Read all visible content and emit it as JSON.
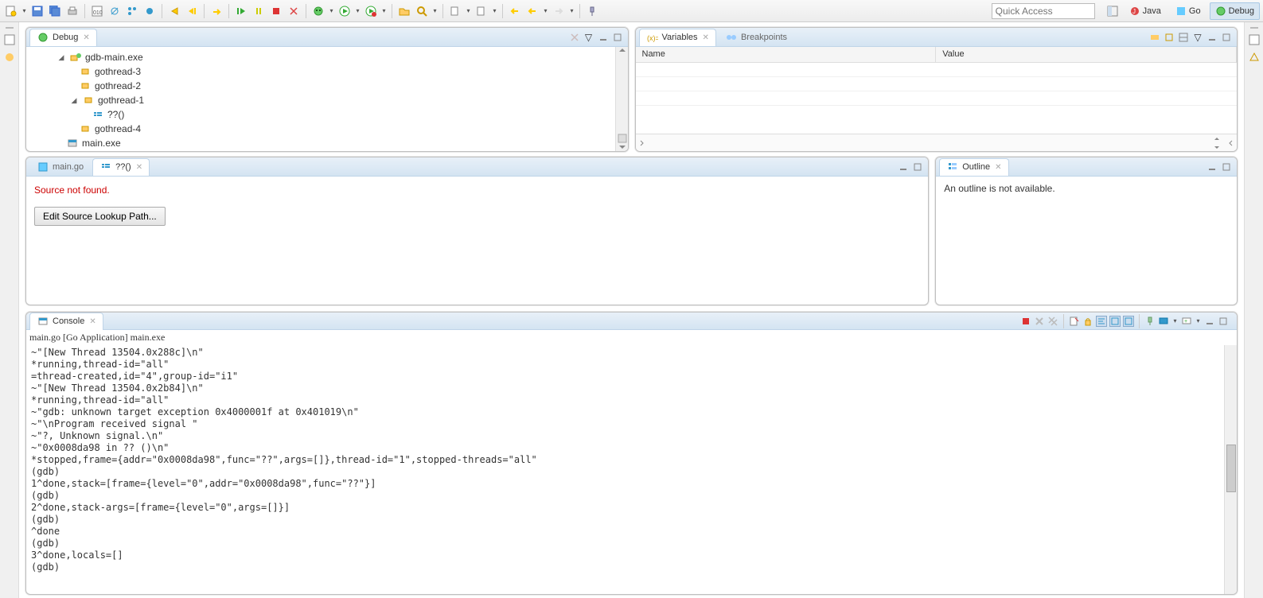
{
  "quick_access_placeholder": "Quick Access",
  "perspectives": {
    "java": "Java",
    "go": "Go",
    "debug": "Debug"
  },
  "debug_view": {
    "title": "Debug",
    "tree": {
      "root": "gdb-main.exe",
      "thread1": "gothread-3",
      "thread2": "gothread-2",
      "thread3": "gothread-1",
      "frame": "??()",
      "thread4": "gothread-4",
      "exe": "main.exe"
    }
  },
  "variables_view": {
    "tab_variables": "Variables",
    "tab_breakpoints": "Breakpoints",
    "col_name": "Name",
    "col_value": "Value"
  },
  "editor": {
    "tab1": "main.go",
    "tab2": "??()",
    "error": "Source not found.",
    "button": "Edit Source Lookup Path..."
  },
  "outline": {
    "title": "Outline",
    "msg": "An outline is not available."
  },
  "console": {
    "title": "Console",
    "subtitle": "main.go [Go Application] main.exe",
    "lines": [
      "~\"[New Thread 13504.0x288c]\\n\"",
      "*running,thread-id=\"all\"",
      "=thread-created,id=\"4\",group-id=\"i1\"",
      "~\"[New Thread 13504.0x2b84]\\n\"",
      "*running,thread-id=\"all\"",
      "~\"gdb: unknown target exception 0x4000001f at 0x401019\\n\"",
      "~\"\\nProgram received signal \"",
      "~\"?, Unknown signal.\\n\"",
      "~\"0x0008da98 in ?? ()\\n\"",
      "*stopped,frame={addr=\"0x0008da98\",func=\"??\",args=[]},thread-id=\"1\",stopped-threads=\"all\"",
      "(gdb) ",
      "1^done,stack=[frame={level=\"0\",addr=\"0x0008da98\",func=\"??\"}]",
      "(gdb) ",
      "2^done,stack-args=[frame={level=\"0\",args=[]}]",
      "(gdb) ",
      "^done",
      "(gdb) ",
      "3^done,locals=[]",
      "(gdb) "
    ]
  }
}
